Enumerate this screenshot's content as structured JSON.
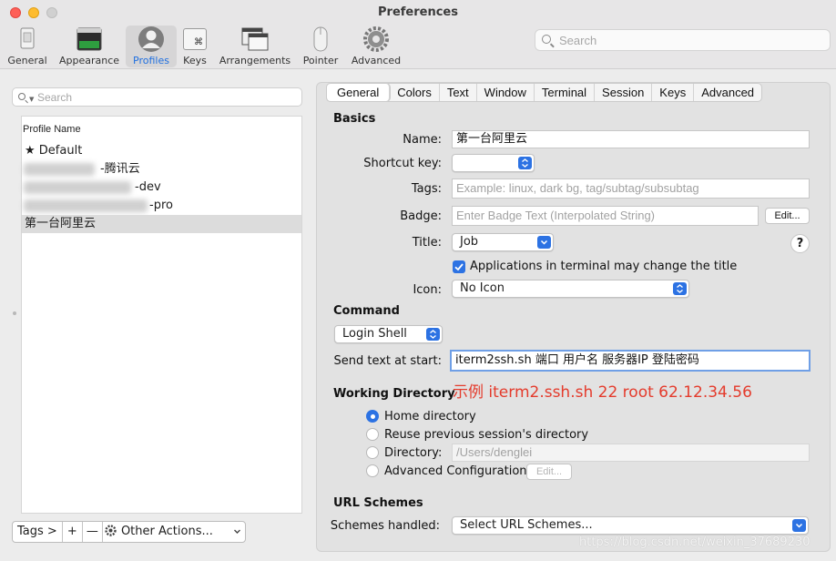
{
  "window": {
    "title": "Preferences"
  },
  "toolbar": {
    "items": [
      {
        "label": "General"
      },
      {
        "label": "Appearance"
      },
      {
        "label": "Profiles"
      },
      {
        "label": "Keys",
        "glyph": "⌘"
      },
      {
        "label": "Arrangements"
      },
      {
        "label": "Pointer"
      },
      {
        "label": "Advanced"
      }
    ],
    "search_placeholder": "Search"
  },
  "sidebar": {
    "search_placeholder": "Search",
    "header": "Profile Name",
    "profiles": [
      {
        "label": "Default",
        "star": "★"
      },
      {
        "label": "-腾讯云"
      },
      {
        "label": "-dev"
      },
      {
        "label": "-pro"
      },
      {
        "label": "第一台阿里云"
      }
    ],
    "bottom": {
      "tags": "Tags >",
      "add": "+",
      "remove": "—",
      "other_actions": "Other Actions..."
    }
  },
  "tabs": [
    "General",
    "Colors",
    "Text",
    "Window",
    "Terminal",
    "Session",
    "Keys",
    "Advanced"
  ],
  "basics": {
    "heading": "Basics",
    "name_label": "Name:",
    "name_value": "第一台阿里云",
    "shortcut_label": "Shortcut key:",
    "shortcut_value": "",
    "tags_label": "Tags:",
    "tags_placeholder": "Example: linux, dark bg, tag/subtag/subsubtag",
    "badge_label": "Badge:",
    "badge_placeholder": "Enter Badge Text (Interpolated String)",
    "badge_edit": "Edit...",
    "title_label": "Title:",
    "title_value": "Job",
    "help": "?",
    "apps_change_title": "Applications in terminal may change the title",
    "icon_label": "Icon:",
    "icon_value": "No Icon"
  },
  "command": {
    "heading": "Command",
    "mode": "Login Shell",
    "send_text_label": "Send text at start:",
    "send_text_value": "iterm2ssh.sh 端口 用户名 服务器IP 登陆密码",
    "example_note": "示例 iterm2.ssh.sh 22 root 62.12.34.56"
  },
  "working_directory": {
    "heading": "Working Directory",
    "options": [
      "Home directory",
      "Reuse previous session's directory",
      "Directory:",
      "Advanced Configuration"
    ],
    "directory_path": "/Users/denglei",
    "edit": "Edit..."
  },
  "url_schemes": {
    "heading": "URL Schemes",
    "handled_label": "Schemes handled:",
    "handled_value": "Select URL Schemes..."
  },
  "watermark": "https://blog.csdn.net/weixin_37689230",
  "colors": {
    "accent": "#2c72e3",
    "note": "#e43b2c",
    "selection": "#dcdcdc"
  }
}
